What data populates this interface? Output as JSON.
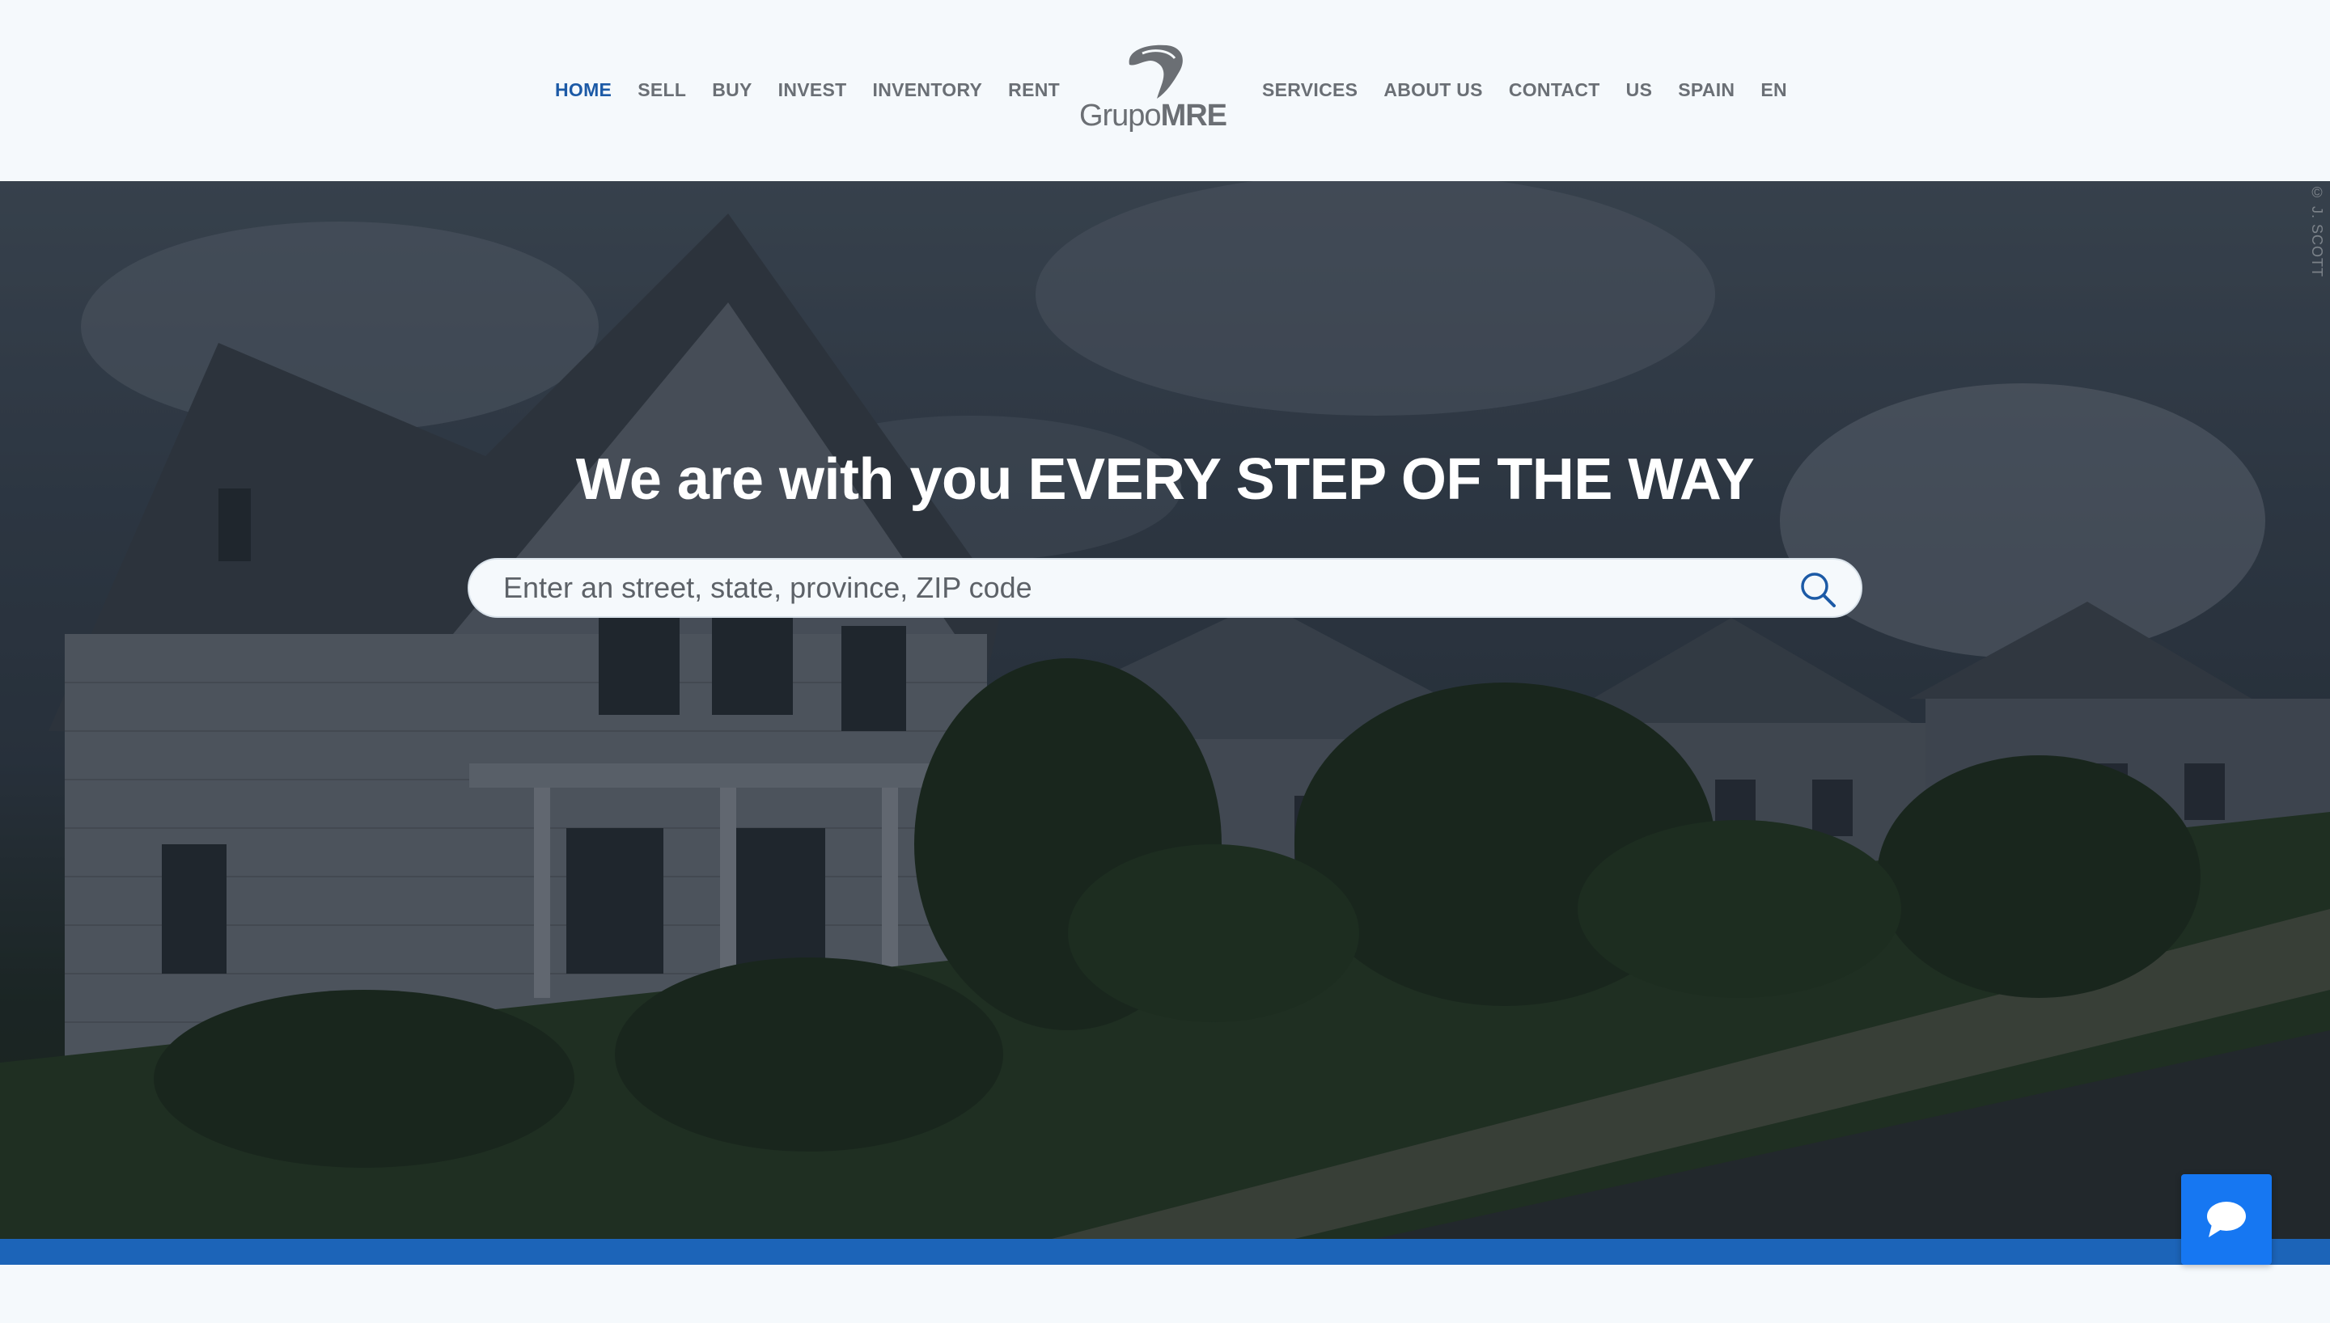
{
  "header": {
    "nav_left": [
      {
        "label": "HOME",
        "active": true
      },
      {
        "label": "SELL"
      },
      {
        "label": "BUY"
      },
      {
        "label": "INVEST"
      },
      {
        "label": "INVENTORY"
      },
      {
        "label": "RENT"
      }
    ],
    "nav_right": [
      {
        "label": "SERVICES"
      },
      {
        "label": "ABOUT US"
      },
      {
        "label": "CONTACT"
      },
      {
        "label": "US"
      },
      {
        "label": "SPAIN"
      },
      {
        "label": "EN"
      }
    ],
    "logo": {
      "text_regular": "Grupo",
      "text_bold": "MRE"
    }
  },
  "hero": {
    "title": "We are with you EVERY STEP OF THE WAY",
    "search": {
      "placeholder": "Enter an street, state, province, ZIP code",
      "value": "",
      "icon": "search-icon"
    },
    "photo_credit": "© J. SCOTT"
  },
  "chat": {
    "icon": "chat-bubble-icon"
  },
  "colors": {
    "accent": "#1c5aa6",
    "strip": "#1c64b8",
    "chat": "#1677f2",
    "nav_text": "#6a6f75",
    "background": "#f5f9fc"
  }
}
